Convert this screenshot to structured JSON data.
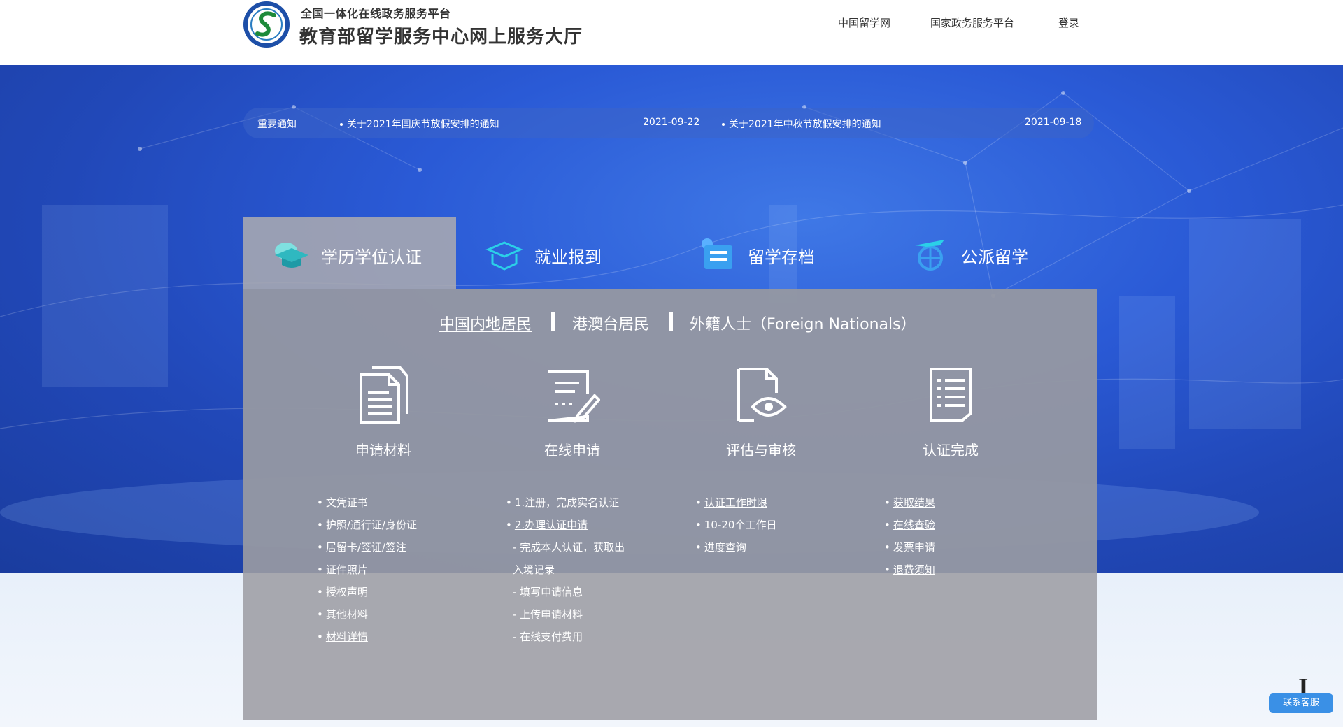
{
  "header": {
    "subtitle": "全国一体化在线政务服务平台",
    "title": "教育部留学服务中心网上服务大厅",
    "nav": [
      "中国留学网",
      "国家政务服务平台",
      "登录"
    ]
  },
  "notice": {
    "label": "重要通知",
    "items": [
      {
        "text": "关于2021年国庆节放假安排的通知",
        "date": "2021-09-22"
      },
      {
        "text": "关于2021年中秋节放假安排的通知",
        "date": "2021-09-18"
      }
    ]
  },
  "tabs": [
    {
      "label": "学历学位认证",
      "icon": "graduation-cap-icon",
      "active": true
    },
    {
      "label": "就业报到",
      "icon": "cap-box-icon",
      "active": false
    },
    {
      "label": "留学存档",
      "icon": "archive-folder-icon",
      "active": false
    },
    {
      "label": "公派留学",
      "icon": "plane-globe-icon",
      "active": false
    }
  ],
  "residency": [
    "中国内地居民",
    "港澳台居民",
    "外籍人士（Foreign Nationals）"
  ],
  "steps": [
    {
      "label": "申请材料",
      "icon": "documents-icon"
    },
    {
      "label": "在线申请",
      "icon": "form-edit-icon"
    },
    {
      "label": "评估与审核",
      "icon": "document-eye-icon"
    },
    {
      "label": "认证完成",
      "icon": "checklist-icon"
    }
  ],
  "lists": {
    "materials": [
      "文凭证书",
      "护照/通行证/身份证",
      "居留卡/签证/签注",
      "证件照片",
      "授权声明",
      "其他材料",
      "材料详情"
    ],
    "apply": [
      "1.注册，完成实名认证",
      "2.办理认证申请",
      "- 完成本人认证，获取出",
      "入境记录",
      "- 填写申请信息",
      "- 上传申请材料",
      "- 在线支付费用"
    ],
    "review": [
      "认证工作时限",
      "10-20个工作日",
      "进度查询"
    ],
    "complete": [
      "获取结果",
      "在线查验",
      "发票申请",
      "退费须知"
    ]
  },
  "help": {
    "label": "联系客服",
    "badge": "J"
  }
}
